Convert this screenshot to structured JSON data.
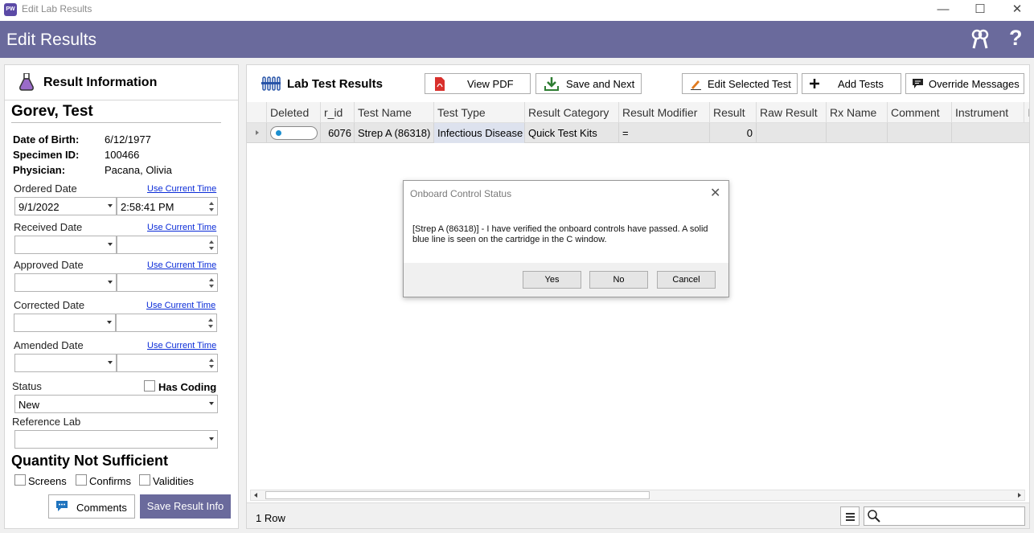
{
  "window": {
    "title": "Edit Lab Results",
    "app_icon_text": "PW",
    "min": "—",
    "max": "☐",
    "close": "✕"
  },
  "header": {
    "title": "Edit Results",
    "help": "?"
  },
  "result_info": {
    "heading": "Result Information",
    "patient_name": "Gorev, Test",
    "dob_label": "Date of Birth:",
    "dob": "6/12/1977",
    "specimen_label": "Specimen ID:",
    "specimen": "100466",
    "physician_label": "Physician:",
    "physician": "Pacana, Olivia",
    "use_current_time": "Use Current Time",
    "ordered": {
      "label": "Ordered Date",
      "date": "9/1/2022",
      "time": "2:58:41 PM"
    },
    "received": {
      "label": "Received Date",
      "date": "",
      "time": ""
    },
    "approved": {
      "label": "Approved Date",
      "date": "",
      "time": ""
    },
    "corrected": {
      "label": "Corrected Date",
      "date": "",
      "time": ""
    },
    "amended": {
      "label": "Amended Date",
      "date": "",
      "time": ""
    },
    "status_label": "Status",
    "status_value": "New",
    "has_coding": "Has Coding",
    "reference_lab_label": "Reference Lab",
    "reference_lab_value": "",
    "qns_heading": "Quantity Not Sufficient",
    "qns_screens": "Screens",
    "qns_confirms": "Confirms",
    "qns_validities": "Validities",
    "comments_btn": "Comments",
    "save_btn": "Save Result Info"
  },
  "lab_results": {
    "title": "Lab Test Results",
    "view_pdf": "View PDF",
    "save_next": "Save and Next",
    "edit_selected": "Edit Selected Test",
    "add_tests": "Add Tests",
    "override": "Override Messages",
    "columns": [
      "Deleted",
      "r_id",
      "Test Name",
      "Test Type",
      "Result Category",
      "Result Modifier",
      "Result",
      "Raw Result",
      "Rx Name",
      "Comment",
      "Instrument",
      "I"
    ],
    "rows": [
      {
        "deleted": "",
        "r_id": "6076",
        "test_name": "Strep A (86318)",
        "test_type": "Infectious Disease",
        "result_category": "Quick Test Kits",
        "result_modifier": "=",
        "result": "0",
        "raw_result": "",
        "rx_name": "",
        "comment": "",
        "instrument": ""
      }
    ],
    "row_count": "1 Row",
    "search_placeholder": ""
  },
  "dialog": {
    "title": "Onboard Control Status",
    "close": "✕",
    "message": "[Strep A (86318)] - I have verified the onboard controls have passed.  A solid blue line is seen on the cartridge in the C window.",
    "yes": "Yes",
    "no": "No",
    "cancel": "Cancel"
  },
  "colors": {
    "header_bg": "#6a6a9c",
    "link": "#0b2cd8",
    "toggle_dot": "#1b8fd0",
    "pdf_red": "#d9302c",
    "save_green": "#2e7d32"
  }
}
